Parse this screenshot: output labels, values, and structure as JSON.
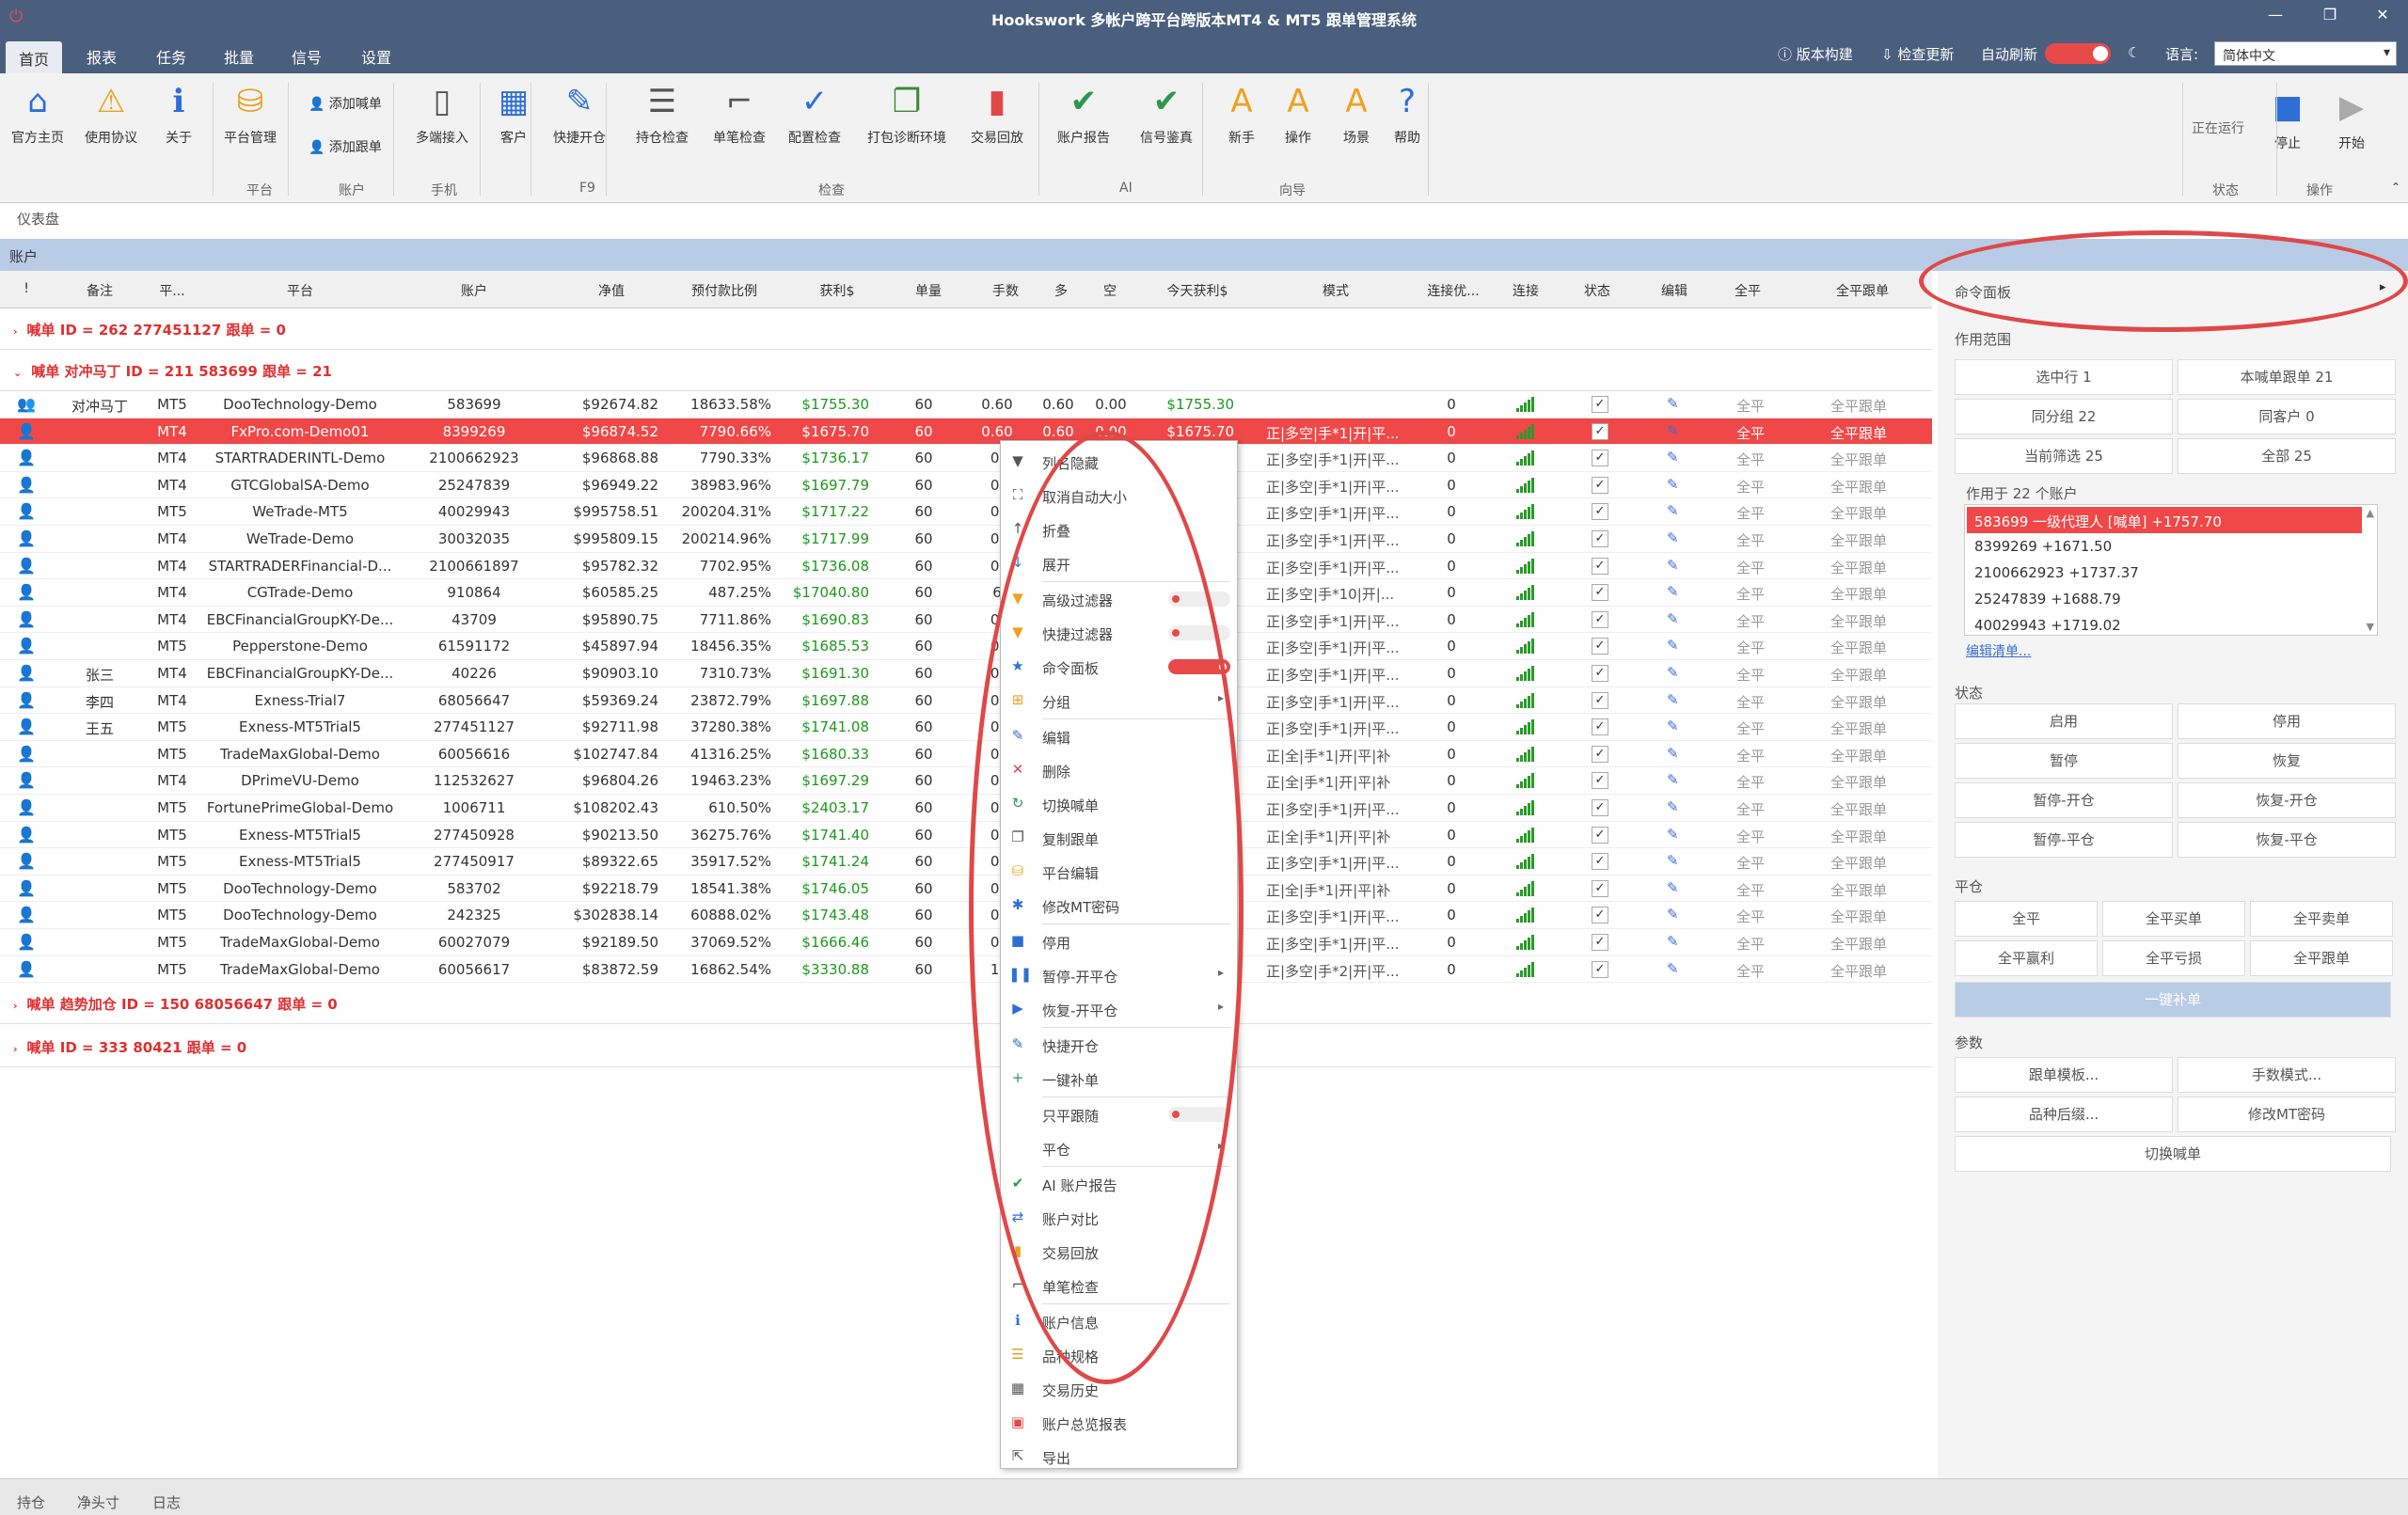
{
  "window": {
    "title": "Hookswork 多帐户跨平台跨版本MT4 & MT5 跟单管理系统",
    "app_icon": "power-icon",
    "controls": [
      "—",
      "❐",
      "✕"
    ]
  },
  "tabs": [
    "首页",
    "报表",
    "任务",
    "批量",
    "信号",
    "设置"
  ],
  "topright": {
    "build": "版本构建",
    "update": "检查更新",
    "auto_refresh": "自动刷新",
    "lang_label": "语言:",
    "lang_value": "简体中文"
  },
  "ribbon": {
    "buttons": [
      {
        "label": "官方主页",
        "icon": "house-icon",
        "glyph": "⌂",
        "color": "#2d6fd6"
      },
      {
        "label": "使用协议",
        "icon": "warning-icon",
        "glyph": "⚠",
        "color": "#f0a020"
      },
      {
        "label": "关于",
        "icon": "info-icon",
        "glyph": "ℹ",
        "color": "#2d6fd6"
      },
      {
        "label": "平台管理",
        "icon": "database-icon",
        "glyph": "⛁",
        "color": "#e8a020"
      },
      {
        "label": "多端接入",
        "icon": "phone-icon",
        "glyph": "▯",
        "color": "#555"
      },
      {
        "label": "客户",
        "icon": "grid-icon",
        "glyph": "▦",
        "color": "#2d6fd6"
      },
      {
        "label": "快捷开仓",
        "icon": "edit-icon",
        "glyph": "✎",
        "color": "#2d6fd6"
      },
      {
        "label": "持仓检查",
        "icon": "checklist-icon",
        "glyph": "☰",
        "color": "#555"
      },
      {
        "label": "单笔检查",
        "icon": "log-icon",
        "glyph": "⌐",
        "color": "#555"
      },
      {
        "label": "配置检查",
        "icon": "abc-check-icon",
        "glyph": "✓",
        "color": "#2d6fd6"
      },
      {
        "label": "打包诊断环境",
        "icon": "package-icon",
        "glyph": "❐",
        "color": "#3a8a3a"
      },
      {
        "label": "交易回放",
        "icon": "chart-icon",
        "glyph": "▮",
        "color": "#e04848"
      },
      {
        "label": "账户报告",
        "icon": "shield-check-icon",
        "glyph": "✔",
        "color": "#2a9a4a"
      },
      {
        "label": "信号鉴真",
        "icon": "shield-check-icon",
        "glyph": "✔",
        "color": "#2a9a4a"
      },
      {
        "label": "新手",
        "icon": "letter-a-icon",
        "glyph": "A",
        "color": "#f0a020"
      },
      {
        "label": "操作",
        "icon": "letter-a-icon",
        "glyph": "A",
        "color": "#f0a020"
      },
      {
        "label": "场景",
        "icon": "letter-a-icon",
        "glyph": "A",
        "color": "#f0a020"
      },
      {
        "label": "帮助",
        "icon": "help-icon",
        "glyph": "?",
        "color": "#2d6fd6"
      },
      {
        "label": "停止",
        "icon": "stop-icon",
        "glyph": "■",
        "color": "#2d6fd6"
      },
      {
        "label": "开始",
        "icon": "play-icon",
        "glyph": "▶",
        "color": "#aaa"
      }
    ],
    "add_master": "添加喊单",
    "add_follower": "添加跟单",
    "running": "正在运行",
    "groups": [
      "平台",
      "账户",
      "手机",
      "F9",
      "检查",
      "AI",
      "向导",
      "状态",
      "操作"
    ]
  },
  "dashboard": "仪表盘",
  "accounts_bar": "账户",
  "columns": [
    "!",
    "备注",
    "平...",
    "平台",
    "账户",
    "净值",
    "预付款比例",
    "获利$",
    "单量",
    "手数",
    "多",
    "空",
    "今天获利$",
    "模式",
    "连接优...",
    "连接",
    "状态",
    "编辑",
    "全平",
    "全平跟单"
  ],
  "groups": [
    {
      "label": "喊单  ID = 262 277451127  跟单 = 0"
    },
    {
      "label": "喊单  对冲马丁 ID = 211 583699  跟单 = 21"
    },
    {
      "label": "喊单  趋势加仓 ID = 150 68056647  跟单 = 0"
    },
    {
      "label": "喊单  ID = 333 80421  跟单 = 0"
    }
  ],
  "rows": [
    {
      "note": "对冲马丁",
      "ver": "MT5",
      "platform": "DooTechnology-Demo",
      "account": "583699",
      "equity": "$92674.82",
      "margin": "18633.58%",
      "profit": "$1755.30",
      "orders": "60",
      "lots": "0.60",
      "long": "0.60",
      "short": "0.00",
      "today": "$1755.30",
      "mode": "",
      "conn": "0",
      "master": true
    },
    {
      "note": "",
      "ver": "MT4",
      "platform": "FxPro.com-Demo01",
      "account": "8399269",
      "equity": "$96874.52",
      "margin": "7790.66%",
      "profit": "$1675.70",
      "orders": "60",
      "lots": "0.60",
      "long": "0.60",
      "short": "0.00",
      "today": "$1675.70",
      "mode": "正|多空|手*1|开|平...",
      "conn": "0",
      "sel": true
    },
    {
      "note": "",
      "ver": "MT4",
      "platform": "STARTRADERINTL-Demo",
      "account": "2100662923",
      "equity": "$96868.88",
      "margin": "7790.33%",
      "profit": "$1736.17",
      "orders": "60",
      "lots": "0.",
      "mode": "正|多空|手*1|开|平...",
      "conn": "0"
    },
    {
      "note": "",
      "ver": "MT4",
      "platform": "GTCGlobalSA-Demo",
      "account": "25247839",
      "equity": "$96949.22",
      "margin": "38983.96%",
      "profit": "$1697.79",
      "orders": "60",
      "lots": "0.",
      "mode": "正|多空|手*1|开|平...",
      "conn": "0"
    },
    {
      "note": "",
      "ver": "MT5",
      "platform": "WeTrade-MT5",
      "account": "40029943",
      "equity": "$995758.51",
      "margin": "200204.31%",
      "profit": "$1717.22",
      "orders": "60",
      "lots": "0.",
      "mode": "正|多空|手*1|开|平...",
      "conn": "0"
    },
    {
      "note": "",
      "ver": "MT4",
      "platform": "WeTrade-Demo",
      "account": "30032035",
      "equity": "$995809.15",
      "margin": "200214.96%",
      "profit": "$1717.99",
      "orders": "60",
      "lots": "0.",
      "mode": "正|多空|手*1|开|平...",
      "conn": "0"
    },
    {
      "note": "",
      "ver": "MT4",
      "platform": "STARTRADERFinancial-D...",
      "account": "2100661897",
      "equity": "$95782.32",
      "margin": "7702.95%",
      "profit": "$1736.08",
      "orders": "60",
      "lots": "0.",
      "mode": "正|多空|手*1|开|平...",
      "conn": "0"
    },
    {
      "note": "",
      "ver": "MT4",
      "platform": "CGTrade-Demo",
      "account": "910864",
      "equity": "$60585.25",
      "margin": "487.25%",
      "profit": "$17040.80",
      "orders": "60",
      "lots": "6",
      "mode": "正|多空|手*10|开|...",
      "conn": "0"
    },
    {
      "note": "",
      "ver": "MT4",
      "platform": "EBCFinancialGroupKY-De...",
      "account": "43709",
      "equity": "$95890.75",
      "margin": "7711.86%",
      "profit": "$1690.83",
      "orders": "60",
      "lots": "0.",
      "mode": "正|多空|手*1|开|平...",
      "conn": "0"
    },
    {
      "note": "",
      "ver": "MT5",
      "platform": "Pepperstone-Demo",
      "account": "61591172",
      "equity": "$45897.94",
      "margin": "18456.35%",
      "profit": "$1685.53",
      "orders": "60",
      "lots": "0.",
      "mode": "正|多空|手*1|开|平...",
      "conn": "0"
    },
    {
      "note": "张三",
      "ver": "MT4",
      "platform": "EBCFinancialGroupKY-De...",
      "account": "40226",
      "equity": "$90903.10",
      "margin": "7310.73%",
      "profit": "$1691.30",
      "orders": "60",
      "lots": "0.",
      "mode": "正|多空|手*1|开|平...",
      "conn": "0"
    },
    {
      "note": "李四",
      "ver": "MT4",
      "platform": "Exness-Trial7",
      "account": "68056647",
      "equity": "$59369.24",
      "margin": "23872.79%",
      "profit": "$1697.88",
      "orders": "60",
      "lots": "0.",
      "mode": "正|多空|手*1|开|平...",
      "conn": "0"
    },
    {
      "note": "王五",
      "ver": "MT5",
      "platform": "Exness-MT5Trial5",
      "account": "277451127",
      "equity": "$92711.98",
      "margin": "37280.38%",
      "profit": "$1741.08",
      "orders": "60",
      "lots": "0.",
      "mode": "正|多空|手*1|开|平...",
      "conn": "0"
    },
    {
      "note": "",
      "ver": "MT5",
      "platform": "TradeMaxGlobal-Demo",
      "account": "60056616",
      "equity": "$102747.84",
      "margin": "41316.25%",
      "profit": "$1680.33",
      "orders": "60",
      "lots": "0.",
      "mode": "正|全|手*1|开|平|补",
      "conn": "0"
    },
    {
      "note": "",
      "ver": "MT4",
      "platform": "DPrimeVU-Demo",
      "account": "112532627",
      "equity": "$96804.26",
      "margin": "19463.23%",
      "profit": "$1697.29",
      "orders": "60",
      "lots": "0.",
      "mode": "正|全|手*1|开|平|补",
      "conn": "0"
    },
    {
      "note": "",
      "ver": "MT5",
      "platform": "FortunePrimeGlobal-Demo",
      "account": "1006711",
      "equity": "$108202.43",
      "margin": "610.50%",
      "profit": "$2403.17",
      "orders": "60",
      "lots": "0.",
      "mode": "正|多空|手*1|开|平...",
      "conn": "0"
    },
    {
      "note": "",
      "ver": "MT5",
      "platform": "Exness-MT5Trial5",
      "account": "277450928",
      "equity": "$90213.50",
      "margin": "36275.76%",
      "profit": "$1741.40",
      "orders": "60",
      "lots": "0.",
      "mode": "正|全|手*1|开|平|补",
      "conn": "0"
    },
    {
      "note": "",
      "ver": "MT5",
      "platform": "Exness-MT5Trial5",
      "account": "277450917",
      "equity": "$89322.65",
      "margin": "35917.52%",
      "profit": "$1741.24",
      "orders": "60",
      "lots": "0.",
      "mode": "正|多空|手*1|开|平...",
      "conn": "0"
    },
    {
      "note": "",
      "ver": "MT5",
      "platform": "DooTechnology-Demo",
      "account": "583702",
      "equity": "$92218.79",
      "margin": "18541.38%",
      "profit": "$1746.05",
      "orders": "60",
      "lots": "0.",
      "mode": "正|全|手*1|开|平|补",
      "conn": "0"
    },
    {
      "note": "",
      "ver": "MT5",
      "platform": "DooTechnology-Demo",
      "account": "242325",
      "equity": "$302838.14",
      "margin": "60888.02%",
      "profit": "$1743.48",
      "orders": "60",
      "lots": "0.",
      "mode": "正|多空|手*1|开|平...",
      "conn": "0"
    },
    {
      "note": "",
      "ver": "MT5",
      "platform": "TradeMaxGlobal-Demo",
      "account": "60027079",
      "equity": "$92189.50",
      "margin": "37069.52%",
      "profit": "$1666.46",
      "orders": "60",
      "lots": "0.",
      "mode": "正|多空|手*1|开|平...",
      "conn": "0"
    },
    {
      "note": "",
      "ver": "MT5",
      "platform": "TradeMaxGlobal-Demo",
      "account": "60056617",
      "equity": "$83872.59",
      "margin": "16862.54%",
      "profit": "$3330.88",
      "orders": "60",
      "lots": "1.",
      "mode": "正|多空|手*2|开|平...",
      "conn": "0"
    }
  ],
  "row_close": "全平",
  "row_close_follow": "全平跟单",
  "check_glyph": "✓",
  "context_menu": [
    {
      "label": "列名隐藏",
      "icon": "filter-icon",
      "glyph": "▼",
      "color": "#555"
    },
    {
      "label": "取消自动大小",
      "icon": "resize-icon",
      "glyph": "⛶",
      "color": "#555"
    },
    {
      "label": "折叠",
      "icon": "collapse-icon",
      "glyph": "↑",
      "color": "#555"
    },
    {
      "label": "展开",
      "icon": "expand-icon",
      "glyph": "↓",
      "color": "#2d6fd6"
    },
    {
      "sep": true
    },
    {
      "label": "高级过滤器",
      "icon": "filter-icon",
      "glyph": "▼",
      "color": "#f0a020",
      "toggle": "off"
    },
    {
      "label": "快捷过滤器",
      "icon": "filter-icon",
      "glyph": "▼",
      "color": "#f0a020",
      "toggle": "off"
    },
    {
      "label": "命令面板",
      "icon": "star-icon",
      "glyph": "★",
      "color": "#2d6fd6",
      "toggle": "on"
    },
    {
      "label": "分组",
      "icon": "group-icon",
      "glyph": "⊞",
      "color": "#f0a020",
      "sub": true
    },
    {
      "sep": true
    },
    {
      "label": "编辑",
      "icon": "pencil-icon",
      "glyph": "✎",
      "color": "#2d6fd6"
    },
    {
      "label": "删除",
      "icon": "delete-icon",
      "glyph": "✕",
      "color": "#e04848"
    },
    {
      "label": "切换喊单",
      "icon": "refresh-icon",
      "glyph": "↻",
      "color": "#2a9a4a"
    },
    {
      "label": "复制跟单",
      "icon": "copy-icon",
      "glyph": "❐",
      "color": "#555"
    },
    {
      "label": "平台编辑",
      "icon": "database-icon",
      "glyph": "⛁",
      "color": "#f0a020"
    },
    {
      "label": "修改MT密码",
      "icon": "key-icon",
      "glyph": "✱",
      "color": "#2d6fd6"
    },
    {
      "sep": true
    },
    {
      "label": "停用",
      "icon": "stop-icon",
      "glyph": "■",
      "color": "#2d6fd6"
    },
    {
      "label": "暂停-开平仓",
      "icon": "pause-icon",
      "glyph": "❚❚",
      "color": "#2d6fd6",
      "sub": true
    },
    {
      "label": "恢复-开平仓",
      "icon": "play-icon",
      "glyph": "▶",
      "color": "#2d6fd6",
      "sub": true
    },
    {
      "sep": true
    },
    {
      "label": "快捷开仓",
      "icon": "edit-icon",
      "glyph": "✎",
      "color": "#2d6fd6"
    },
    {
      "label": "一键补单",
      "icon": "plus-icon",
      "glyph": "+",
      "color": "#2a9a4a"
    },
    {
      "sep": true
    },
    {
      "label": "只平跟随",
      "icon": "none",
      "glyph": "",
      "color": "#555",
      "toggle": "off"
    },
    {
      "label": "平仓",
      "icon": "none",
      "glyph": "",
      "color": "#555",
      "sub": true
    },
    {
      "sep": true
    },
    {
      "label": "AI 账户报告",
      "icon": "shield-check-icon",
      "glyph": "✔",
      "color": "#2a9a4a"
    },
    {
      "label": "账户对比",
      "icon": "compare-icon",
      "glyph": "⇄",
      "color": "#2d6fd6"
    },
    {
      "label": "交易回放",
      "icon": "chart-icon",
      "glyph": "▮",
      "color": "#f0a020"
    },
    {
      "label": "单笔检查",
      "icon": "log-icon",
      "glyph": "⌐",
      "color": "#555"
    },
    {
      "sep": true
    },
    {
      "label": "账户信息",
      "icon": "info-icon",
      "glyph": "ℹ",
      "color": "#2d6fd6"
    },
    {
      "label": "品种规格",
      "icon": "list-icon",
      "glyph": "☰",
      "color": "#e0a020"
    },
    {
      "label": "交易历史",
      "icon": "table-icon",
      "glyph": "▦",
      "color": "#555"
    },
    {
      "label": "账户总览报表",
      "icon": "report-icon",
      "glyph": "▣",
      "color": "#e04848"
    },
    {
      "label": "导出",
      "icon": "export-icon",
      "glyph": "⇱",
      "color": "#555"
    }
  ],
  "panel": {
    "title": "命令面板",
    "scope_label": "作用范围",
    "scope": [
      "选中行  1",
      "本喊单跟单  21",
      "同分组  22",
      "同客户  0",
      "当前筛选  25",
      "全部  25"
    ],
    "applies": "作用于 22 个账户",
    "accounts": [
      "583699  一级代理人 [喊单] +1757.70",
      "8399269  +1671.50",
      "2100662923  +1737.37",
      "25247839  +1688.79",
      "40029943  +1719.02"
    ],
    "edit_list": "编辑清单...",
    "status_label": "状态",
    "status": [
      "启用",
      "停用",
      "暂停",
      "恢复",
      "暂停-开仓",
      "恢复-开仓",
      "暂停-平仓",
      "恢复-平仓"
    ],
    "close_label": "平仓",
    "close": [
      "全平",
      "全平买单",
      "全平卖单",
      "全平赢利",
      "全平亏损",
      "全平跟单"
    ],
    "oneclick": "一键补单",
    "param_label": "参数",
    "params": [
      "跟单模板...",
      "手数模式...",
      "品种后缀...",
      "修改MT密码",
      "切换喊单"
    ]
  },
  "statusbar": [
    "持仓",
    "净头寸",
    "日志"
  ]
}
